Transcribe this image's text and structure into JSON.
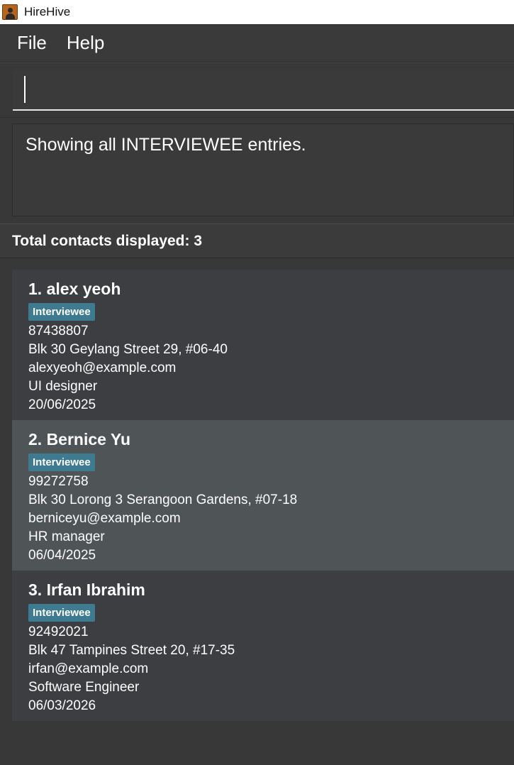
{
  "window": {
    "title": "HireHive"
  },
  "menu": {
    "items": [
      "File",
      "Help"
    ]
  },
  "command": {
    "value": ""
  },
  "result": {
    "text": "Showing all INTERVIEWEE entries."
  },
  "status": {
    "text": "Total contacts displayed: 3"
  },
  "contacts": [
    {
      "heading": "1. alex yeoh",
      "tag": "Interviewee",
      "phone": "87438807",
      "address": "Blk 30 Geylang Street 29, #06-40",
      "email": "alexyeoh@example.com",
      "role": "UI designer",
      "date": "20/06/2025"
    },
    {
      "heading": "2. Bernice Yu",
      "tag": "Interviewee",
      "phone": "99272758",
      "address": "Blk 30 Lorong 3 Serangoon Gardens, #07-18",
      "email": "berniceyu@example.com",
      "role": "HR manager",
      "date": "06/04/2025"
    },
    {
      "heading": "3. Irfan Ibrahim",
      "tag": "Interviewee",
      "phone": "92492021",
      "address": "Blk 47 Tampines Street 20, #17-35",
      "email": "irfan@example.com",
      "role": "Software Engineer",
      "date": "06/03/2026"
    }
  ],
  "colors": {
    "background": "#383838",
    "tag": "#3e7b91",
    "selected_row": "#4f5457"
  }
}
